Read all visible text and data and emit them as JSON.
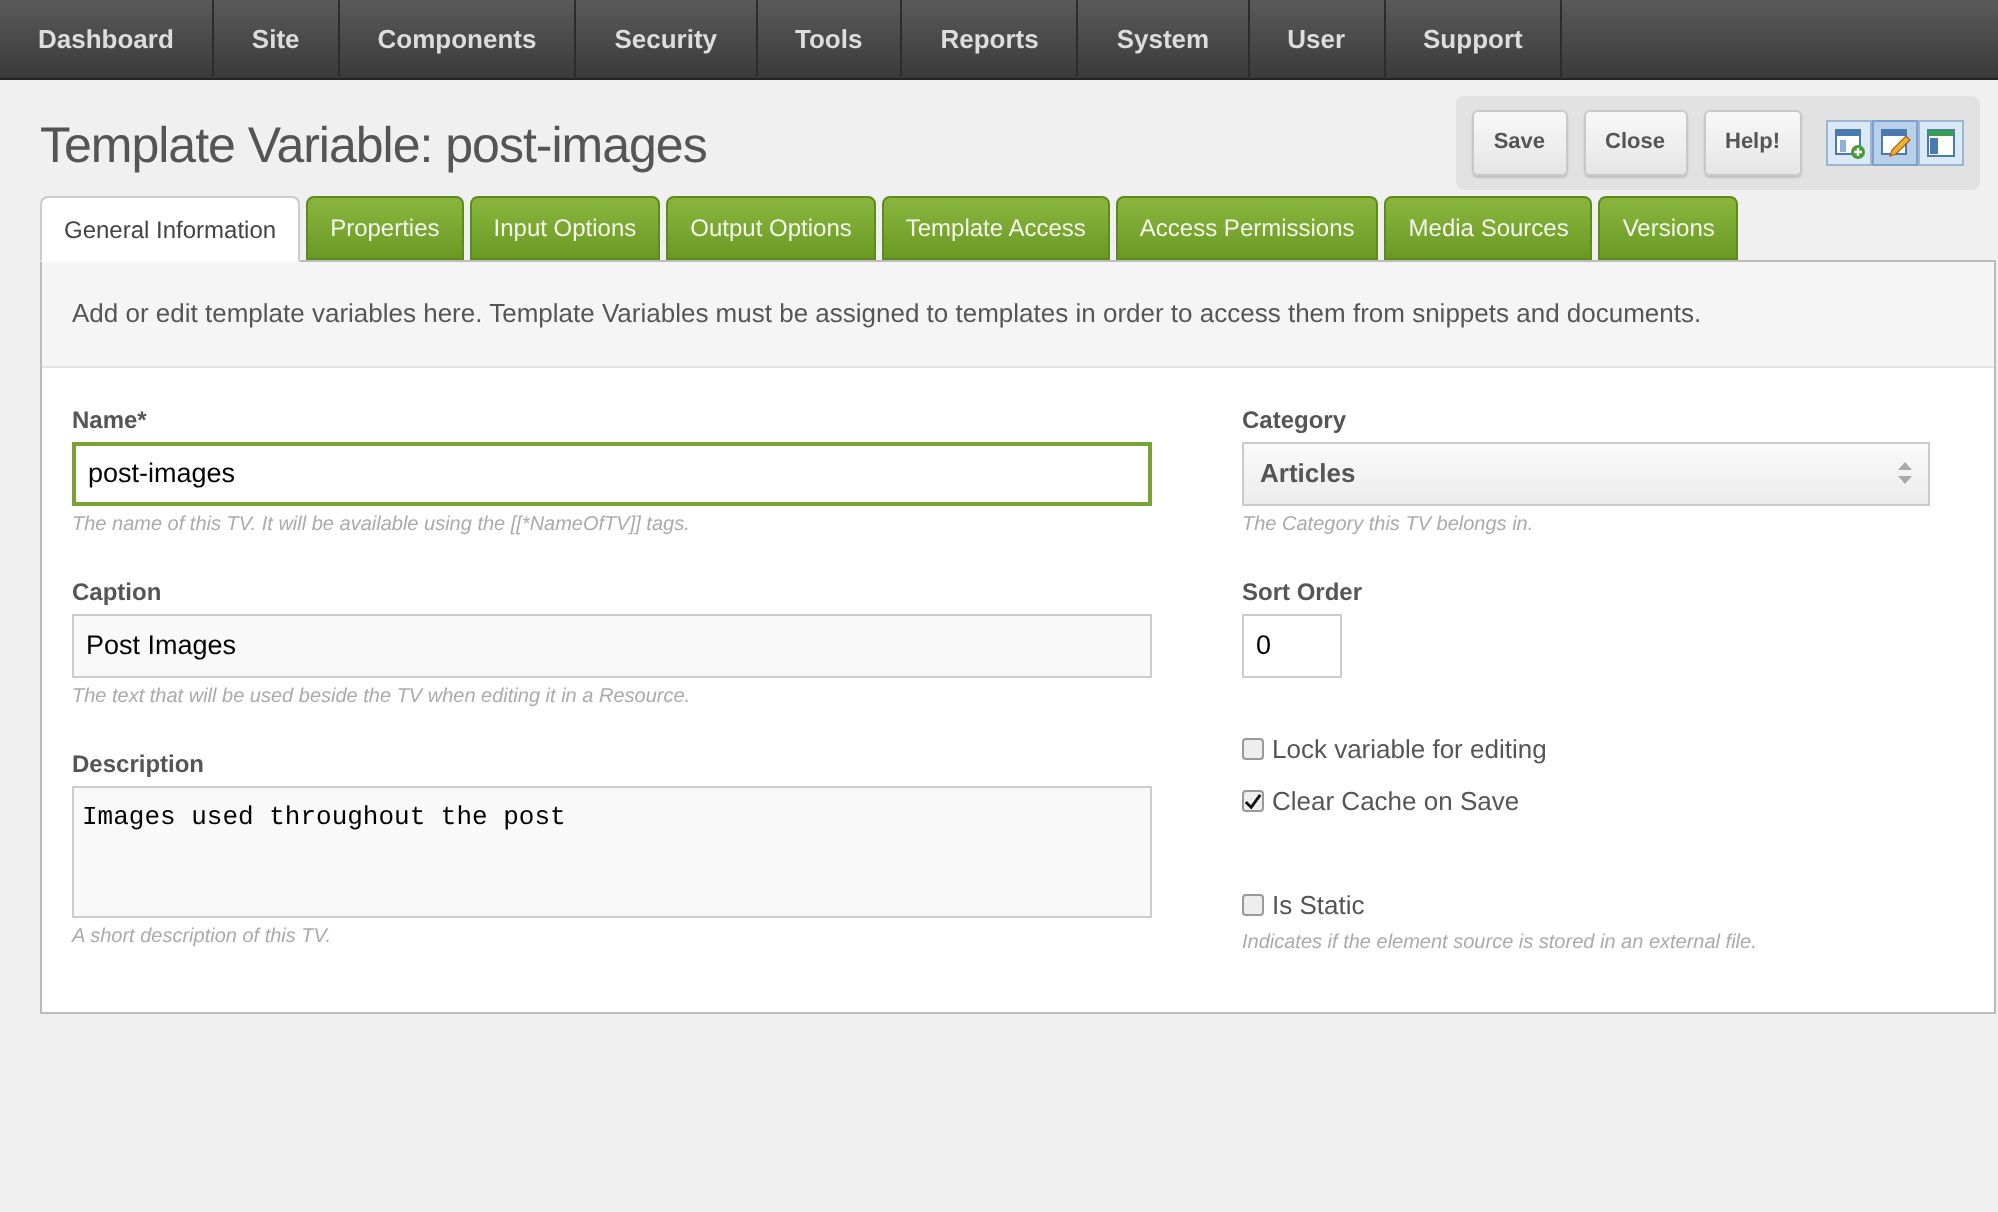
{
  "menu": [
    {
      "label": "Dashboard"
    },
    {
      "label": "Site"
    },
    {
      "label": "Components"
    },
    {
      "label": "Security"
    },
    {
      "label": "Tools"
    },
    {
      "label": "Reports"
    },
    {
      "label": "System"
    },
    {
      "label": "User"
    },
    {
      "label": "Support"
    }
  ],
  "title": "Template Variable: post-images",
  "actions": [
    {
      "label": "Save"
    },
    {
      "label": "Close"
    },
    {
      "label": "Help!"
    }
  ],
  "view_buttons": [
    {
      "kind": "new",
      "selected": false
    },
    {
      "kind": "edit",
      "selected": true
    },
    {
      "kind": "layout",
      "selected": false
    }
  ],
  "tabs": [
    {
      "label": "General Information",
      "selected": true
    },
    {
      "label": "Properties",
      "selected": false
    },
    {
      "label": "Input Options",
      "selected": false
    },
    {
      "label": "Output Options",
      "selected": false
    },
    {
      "label": "Template Access",
      "selected": false
    },
    {
      "label": "Access Permissions",
      "selected": false
    },
    {
      "label": "Media Sources",
      "selected": false
    },
    {
      "label": "Versions",
      "selected": false
    }
  ],
  "intro": "Add or edit template variables here. Template Variables must be assigned to templates in order to access them from snippets and documents.",
  "left_fields": [
    {
      "kind": "text",
      "label": "Name*",
      "value": "post-images",
      "focused": true,
      "help": "The name of this TV. It will be available using the [[*NameOfTV]] tags."
    },
    {
      "kind": "text",
      "label": "Caption",
      "value": "Post Images",
      "focused": false,
      "help": "The text that will be used beside the TV when editing it in a Resource."
    },
    {
      "kind": "textarea",
      "label": "Description",
      "value": "Images used throughout the post",
      "focused": false,
      "help": "A short description of this TV."
    }
  ],
  "category": {
    "label": "Category",
    "value": "Articles",
    "help": "The Category this TV belongs in."
  },
  "sort_order": {
    "label": "Sort Order",
    "value": "0"
  },
  "checkboxes": [
    {
      "label": "Lock variable for editing",
      "checked": false
    },
    {
      "label": "Clear Cache on Save",
      "checked": true
    },
    {
      "label": "Is Static",
      "checked": false,
      "help": "Indicates if the element source is stored in an external file."
    }
  ]
}
